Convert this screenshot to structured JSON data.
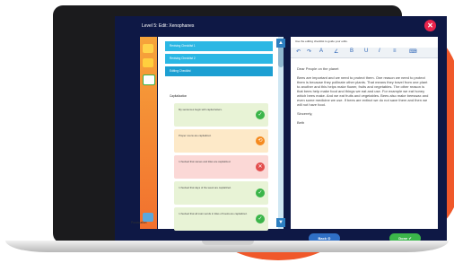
{
  "window": {
    "title": "Level 5: Edit: Xenophanes",
    "close_glyph": "✕"
  },
  "accordions": [
    {
      "label": "Revising Checklist 1"
    },
    {
      "label": "Revising Checklist 2"
    },
    {
      "label": "Editing Checklist"
    }
  ],
  "section_label": "Capitalization",
  "checklist": [
    {
      "text": "My sentences begin with capital letters.",
      "bg": "#e8f3d6",
      "btn": "#3bb54a",
      "glyph": "✓"
    },
    {
      "text": "Proper nouns are capitalized.",
      "bg": "#fde9c8",
      "btn": "#f58a1f",
      "glyph": "⟲"
    },
    {
      "text": "I checked that names and titles are capitalized.",
      "bg": "#fbd8d6",
      "btn": "#e24d4d",
      "glyph": "✕"
    },
    {
      "text": "I checked that days of the week are capitalized.",
      "bg": "#e8f3d6",
      "btn": "#3bb54a",
      "glyph": "✓"
    },
    {
      "text": "I checked that all main words in titles of books are capitalized.",
      "bg": "#e8f3d6",
      "btn": "#3bb54a",
      "glyph": "✓"
    }
  ],
  "next_section_label": "Punctuation",
  "editor": {
    "hint": "Use the editing checklist to guide your edits.",
    "toolbar": [
      "↶",
      "↷",
      "A",
      "∠",
      "B",
      "U",
      "I",
      "≡",
      "⌨"
    ],
    "greeting": "Dear People on the planet",
    "body": "Bees are important and we need to protect them. One reason we need to protect them is because they pollinate other plants. That means they travel from one plant to another and this helps make flower, fruits and vegetables. The other reason is that bees help make food and things we eat and use. For example we eat honey which bees make. And we eat fruits and vegetables. Bees also make beeswax and even some medicine we use. If bees are extinct we do not save them and then we will not have food.",
    "closing": "Sincerely,",
    "signature": "Beth"
  },
  "buttons": {
    "back": "Back ⊙",
    "done": "Done ✔"
  }
}
